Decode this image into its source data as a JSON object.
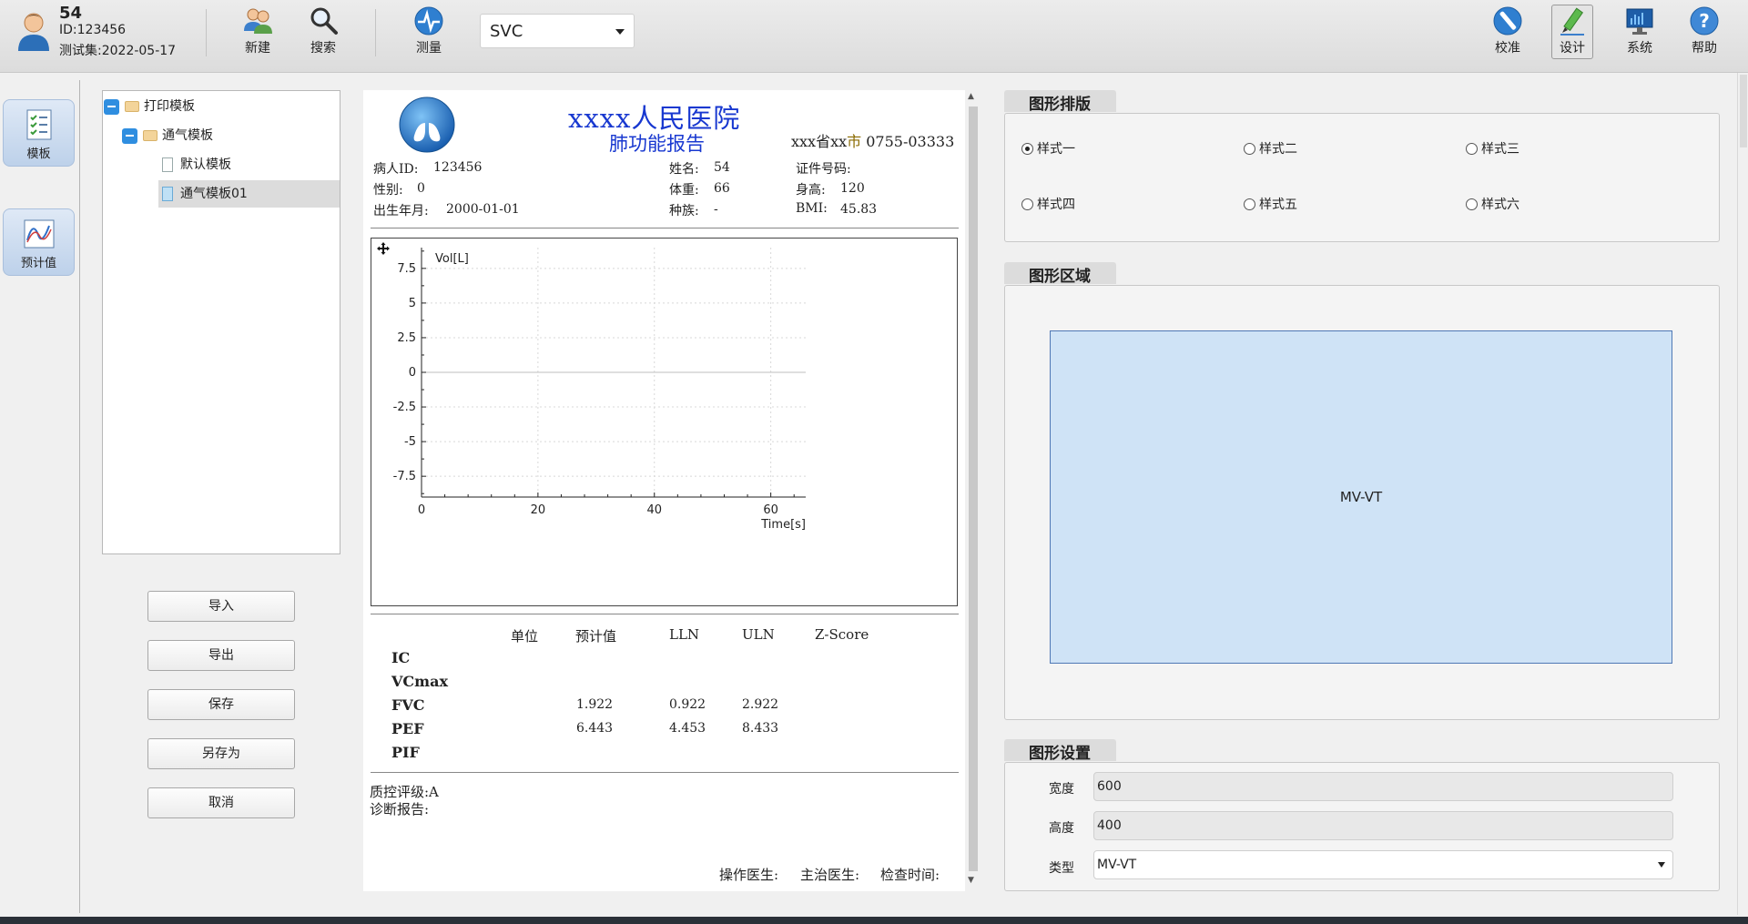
{
  "user": {
    "name": "54",
    "id_text": "ID:123456",
    "date_text": "测试集:2022-05-17"
  },
  "toolbar": {
    "new_label": "新建",
    "search_label": "搜索",
    "measure_label": "测量",
    "mode_value": "SVC",
    "calibrate_label": "校准",
    "design_label": "设计",
    "system_label": "系统",
    "help_label": "帮助"
  },
  "nav": {
    "template_label": "模板",
    "predicted_label": "预计值"
  },
  "tree": {
    "root": "打印模板",
    "group": "通气模板",
    "items": [
      "默认模板",
      "通气模板01"
    ]
  },
  "actions": {
    "import": "导入",
    "export": "导出",
    "save": "保存",
    "save_as": "另存为",
    "cancel": "取消"
  },
  "report": {
    "hospital": "xxxx人民医院",
    "title": "肺功能报告",
    "address_a": "xxx省xx",
    "address_b": "市",
    "address_c": " 0755-03333",
    "patient_id_label": "病人ID:",
    "patient_id": "123456",
    "gender_label": "性别:",
    "gender": "0",
    "dob_label": "出生年月:",
    "dob": "2000-01-01",
    "name_label": "姓名:",
    "name": "54",
    "weight_label": "体重:",
    "weight": "66",
    "race_label": "种族:",
    "race": "-",
    "cert_label": "证件号码:",
    "height_label": "身高:",
    "height": "120",
    "bmi_label": "BMI:",
    "bmi": "45.83",
    "table_headers": [
      "单位",
      "预计值",
      "LLN",
      "ULN",
      "Z-Score"
    ],
    "rows": [
      {
        "name": "IC",
        "pred": "",
        "lln": "",
        "uln": ""
      },
      {
        "name": "VCmax",
        "pred": "",
        "lln": "",
        "uln": ""
      },
      {
        "name": "FVC",
        "pred": "1.922",
        "lln": "0.922",
        "uln": "2.922"
      },
      {
        "name": "PEF",
        "pred": "6.443",
        "lln": "4.453",
        "uln": "8.433"
      },
      {
        "name": "PIF",
        "pred": "",
        "lln": "",
        "uln": ""
      }
    ],
    "qc": "质控评级:A",
    "diagnosis": "诊断报告:",
    "operator_label": "操作医生:",
    "attending_label": "主治医生:",
    "exam_time_label": "检查时间:"
  },
  "chart_data": {
    "type": "line",
    "xlabel": "Time[s]",
    "ylabel": "Vol[L]",
    "xlim": [
      0,
      66
    ],
    "ylim": [
      -9,
      9
    ],
    "x_ticks": [
      0,
      20,
      40,
      60
    ],
    "y_ticks": [
      7.5,
      5,
      2.5,
      0,
      -2.5,
      -5,
      -7.5
    ],
    "y_tick_labels": [
      "7.5",
      "5",
      "2.5",
      "0",
      "-2.5",
      "-5",
      "-7.5"
    ],
    "grid": true,
    "series": []
  },
  "layout_panel": {
    "title": "图形排版",
    "options": [
      "样式一",
      "样式二",
      "样式三",
      "样式四",
      "样式五",
      "样式六"
    ],
    "selected": "样式一"
  },
  "area_panel": {
    "title": "图形区域",
    "graph_label": "MV-VT"
  },
  "settings_panel": {
    "title": "图形设置",
    "width_label": "宽度",
    "width_value": "600",
    "height_label": "高度",
    "height_value": "400",
    "type_label": "类型",
    "type_value": "MV-VT"
  },
  "colors": {
    "accent": "#1838d0",
    "graph_fill": "#cfe3f6",
    "tree_selected": "#dcdcdc"
  }
}
